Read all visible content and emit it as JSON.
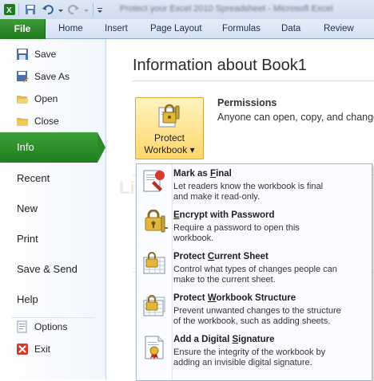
{
  "window": {
    "title": "Protect your Excel 2010 Spreadsheet - Microsoft Excel"
  },
  "quick_access": {
    "icons": [
      "save-icon",
      "undo-icon",
      "redo-icon",
      "customize-icon"
    ]
  },
  "ribbon": {
    "file_tab": "File",
    "tabs": [
      "Home",
      "Insert",
      "Page Layout",
      "Formulas",
      "Data",
      "Review"
    ]
  },
  "nav": {
    "save": "Save",
    "save_as": "Save As",
    "open": "Open",
    "close": "Close",
    "info": "Info",
    "recent": "Recent",
    "new": "New",
    "print": "Print",
    "save_send": "Save & Send",
    "help": "Help",
    "options": "Options",
    "exit": "Exit"
  },
  "main": {
    "heading": "Information about Book1",
    "protect_button": {
      "line1": "Protect",
      "line2": "Workbook",
      "arrow": "▾"
    },
    "permissions_title": "Permissions",
    "permissions_desc": "Anyone can open, copy, and change",
    "watermark": "LiveSkill"
  },
  "menu": {
    "items": [
      {
        "title_pre": "Mark as ",
        "title_u": "F",
        "title_post": "inal",
        "desc1": "Let readers know the workbook is final",
        "desc2": "and make it read-only.",
        "icon": "mark-final-icon"
      },
      {
        "title_pre": "",
        "title_u": "E",
        "title_post": "ncrypt with Password",
        "desc1": "Require a password to open this",
        "desc2": "workbook.",
        "icon": "encrypt-lock-icon"
      },
      {
        "title_pre": "Protect ",
        "title_u": "C",
        "title_post": "urrent Sheet",
        "desc1": "Control what types of changes people can",
        "desc2": "make to the current sheet.",
        "icon": "protect-sheet-icon"
      },
      {
        "title_pre": "Protect ",
        "title_u": "W",
        "title_post": "orkbook Structure",
        "desc1": "Prevent unwanted changes to the structure",
        "desc2": "of the workbook, such as adding sheets.",
        "icon": "protect-structure-icon"
      },
      {
        "title_pre": "Add a Digital ",
        "title_u": "S",
        "title_post": "ignature",
        "desc1": "Ensure the integrity of the workbook by",
        "desc2": "adding an invisible digital signature.",
        "icon": "digital-signature-icon"
      }
    ]
  }
}
